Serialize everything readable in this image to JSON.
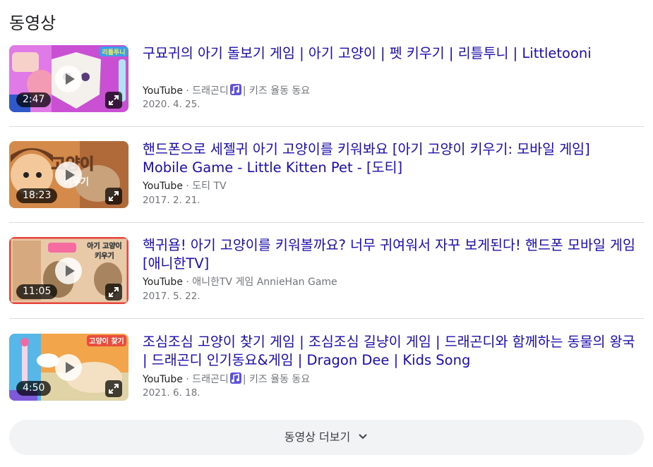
{
  "section": {
    "title": "동영상"
  },
  "videos": [
    {
      "title": "구묘귀의 아기 돌보기 게임 | 아기 고양이 | 펫 키우기 | 리틀투니 | Littletooni",
      "source": "YouTube",
      "channel_a": "드래곤디",
      "channel_b": "| 키즈 율동 동요",
      "has_note_icon": true,
      "date": "2020. 4. 25.",
      "duration": "2:47",
      "thumb_badge": "리틀투니"
    },
    {
      "title": "핸드폰으로 세젤귀 아기 고양이를 키워봐요 [아기 고양이 키우기: 모바일 게임] Mobile Game - Little Kitten Pet - [도티]",
      "source": "YouTube",
      "channel_a": "도티 TV",
      "channel_b": "",
      "has_note_icon": false,
      "date": "2017. 2. 21.",
      "duration": "18:23",
      "thumb_badge": "고양이 키우기"
    },
    {
      "title": "핵귀욤! 아기 고양이를 키워볼까요? 너무 귀여워서 자꾸 보게된다! 핸드폰 모바일 게임 [애니한TV]",
      "source": "YouTube",
      "channel_a": "애니한TV 게임 AnnieHan Game",
      "channel_b": "",
      "has_note_icon": false,
      "date": "2017. 5. 22.",
      "duration": "11:05",
      "thumb_badge": "아기 고양이 키우기"
    },
    {
      "title": "조심조심 고양이 찾기 게임 | 조심조심 길냥이 게임 | 드래곤디와 함께하는 동물의 왕국 | 드래곤디 인기동요&게임 | Dragon Dee | Kids Song",
      "source": "YouTube",
      "channel_a": "드래곤디",
      "channel_b": "| 키즈 율동 동요",
      "has_note_icon": true,
      "date": "2021. 6. 18.",
      "duration": "4:50",
      "thumb_badge": "고양이 찾기"
    }
  ],
  "more_button": {
    "label": "동영상 더보기",
    "icon": "chevron-down-icon"
  },
  "colors": {
    "link": "#1a0dab",
    "muted": "#70757a",
    "button_bg": "#f1f3f4"
  }
}
